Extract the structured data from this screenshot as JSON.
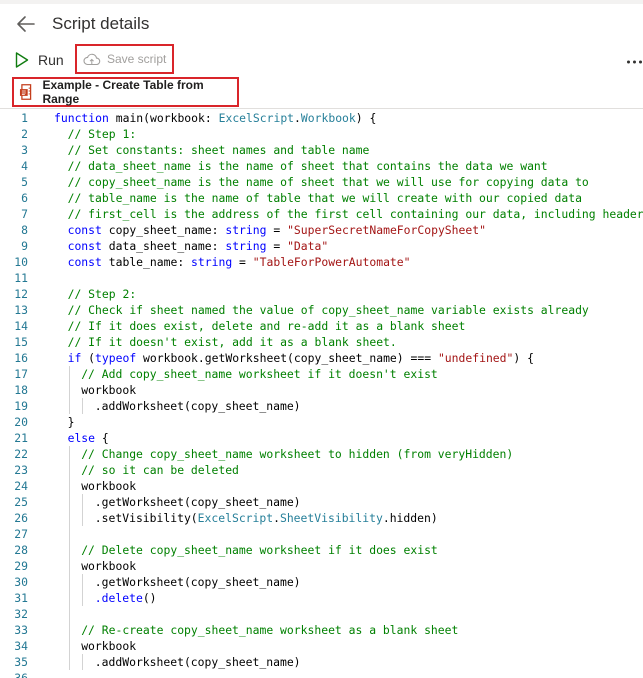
{
  "header": {
    "title": "Script details",
    "back_icon": "arrow-left-icon"
  },
  "toolbar": {
    "run_label": "Run",
    "save_label": "Save script",
    "more_label": "⋯"
  },
  "script": {
    "name": "Example - Create Table from Range"
  },
  "colors": {
    "highlight_border": "#d9252a",
    "run_icon": "#107c10",
    "comment": "#008000",
    "keyword": "#0000ff",
    "string": "#a31515",
    "type": "#267f99",
    "line_number": "#237893"
  },
  "code_lines": [
    {
      "n": "1",
      "indent": 0,
      "tokens": [
        {
          "t": "function",
          "k": "kw"
        },
        {
          "t": " main(workbook: ",
          "k": "plain"
        },
        {
          "t": "ExcelScript",
          "k": "type"
        },
        {
          "t": ".",
          "k": "plain"
        },
        {
          "t": "Workbook",
          "k": "type"
        },
        {
          "t": ") {",
          "k": "plain"
        }
      ]
    },
    {
      "n": "2",
      "indent": 1,
      "tokens": [
        {
          "t": "// Step 1:",
          "k": "com"
        }
      ]
    },
    {
      "n": "3",
      "indent": 1,
      "tokens": [
        {
          "t": "// Set constants: sheet names and table name",
          "k": "com"
        }
      ]
    },
    {
      "n": "4",
      "indent": 1,
      "tokens": [
        {
          "t": "// data_sheet_name is the name of sheet that contains the data we want",
          "k": "com"
        }
      ]
    },
    {
      "n": "5",
      "indent": 1,
      "tokens": [
        {
          "t": "// copy_sheet_name is the name of sheet that we will use for copying data to",
          "k": "com"
        }
      ]
    },
    {
      "n": "6",
      "indent": 1,
      "tokens": [
        {
          "t": "// table_name is the name of table that we will create with our copied data",
          "k": "com"
        }
      ]
    },
    {
      "n": "7",
      "indent": 1,
      "tokens": [
        {
          "t": "// first_cell is the address of the first cell containing our data, including headers",
          "k": "com"
        }
      ]
    },
    {
      "n": "8",
      "indent": 1,
      "tokens": [
        {
          "t": "const",
          "k": "kw"
        },
        {
          "t": " copy_sheet_name: ",
          "k": "plain"
        },
        {
          "t": "string",
          "k": "kw"
        },
        {
          "t": " = ",
          "k": "plain"
        },
        {
          "t": "\"SuperSecretNameForCopySheet\"",
          "k": "str"
        }
      ]
    },
    {
      "n": "9",
      "indent": 1,
      "tokens": [
        {
          "t": "const",
          "k": "kw"
        },
        {
          "t": " data_sheet_name: ",
          "k": "plain"
        },
        {
          "t": "string",
          "k": "kw"
        },
        {
          "t": " = ",
          "k": "plain"
        },
        {
          "t": "\"Data\"",
          "k": "str"
        }
      ]
    },
    {
      "n": "10",
      "indent": 1,
      "tokens": [
        {
          "t": "const",
          "k": "kw"
        },
        {
          "t": " table_name: ",
          "k": "plain"
        },
        {
          "t": "string",
          "k": "kw"
        },
        {
          "t": " = ",
          "k": "plain"
        },
        {
          "t": "\"TableForPowerAutomate\"",
          "k": "str"
        }
      ]
    },
    {
      "n": "11",
      "indent": 1,
      "tokens": []
    },
    {
      "n": "12",
      "indent": 1,
      "tokens": [
        {
          "t": "// Step 2:",
          "k": "com"
        }
      ]
    },
    {
      "n": "13",
      "indent": 1,
      "tokens": [
        {
          "t": "// Check if sheet named the value of copy_sheet_name variable exists already",
          "k": "com"
        }
      ]
    },
    {
      "n": "14",
      "indent": 1,
      "tokens": [
        {
          "t": "// If it does exist, delete and re-add it as a blank sheet",
          "k": "com"
        }
      ]
    },
    {
      "n": "15",
      "indent": 1,
      "tokens": [
        {
          "t": "// If it doesn't exist, add it as a blank sheet.",
          "k": "com"
        }
      ]
    },
    {
      "n": "16",
      "indent": 1,
      "tokens": [
        {
          "t": "if",
          "k": "kw"
        },
        {
          "t": " (",
          "k": "plain"
        },
        {
          "t": "typeof",
          "k": "kw"
        },
        {
          "t": " workbook.getWorksheet(copy_sheet_name) === ",
          "k": "plain"
        },
        {
          "t": "\"undefined\"",
          "k": "str"
        },
        {
          "t": ") {",
          "k": "plain"
        }
      ]
    },
    {
      "n": "17",
      "indent": 2,
      "tokens": [
        {
          "t": "// Add copy_sheet_name worksheet if it doesn't exist",
          "k": "com"
        }
      ]
    },
    {
      "n": "18",
      "indent": 2,
      "tokens": [
        {
          "t": "workbook",
          "k": "plain"
        }
      ]
    },
    {
      "n": "19",
      "indent": 3,
      "tokens": [
        {
          "t": ".addWorksheet(copy_sheet_name)",
          "k": "plain"
        }
      ]
    },
    {
      "n": "20",
      "indent": 1,
      "tokens": [
        {
          "t": "}",
          "k": "plain"
        }
      ]
    },
    {
      "n": "21",
      "indent": 1,
      "tokens": [
        {
          "t": "else",
          "k": "kw"
        },
        {
          "t": " {",
          "k": "plain"
        }
      ]
    },
    {
      "n": "22",
      "indent": 2,
      "tokens": [
        {
          "t": "// Change copy_sheet_name worksheet to hidden (from veryHidden)",
          "k": "com"
        }
      ]
    },
    {
      "n": "23",
      "indent": 2,
      "tokens": [
        {
          "t": "// so it can be deleted",
          "k": "com"
        }
      ]
    },
    {
      "n": "24",
      "indent": 2,
      "tokens": [
        {
          "t": "workbook",
          "k": "plain"
        }
      ]
    },
    {
      "n": "25",
      "indent": 3,
      "tokens": [
        {
          "t": ".getWorksheet(copy_sheet_name)",
          "k": "plain"
        }
      ]
    },
    {
      "n": "26",
      "indent": 3,
      "tokens": [
        {
          "t": ".setVisibility(",
          "k": "plain"
        },
        {
          "t": "ExcelScript",
          "k": "type"
        },
        {
          "t": ".",
          "k": "plain"
        },
        {
          "t": "SheetVisibility",
          "k": "type"
        },
        {
          "t": ".hidden)",
          "k": "plain"
        }
      ]
    },
    {
      "n": "27",
      "indent": 2,
      "tokens": []
    },
    {
      "n": "28",
      "indent": 2,
      "tokens": [
        {
          "t": "// Delete copy_sheet_name worksheet if it does exist",
          "k": "com"
        }
      ]
    },
    {
      "n": "29",
      "indent": 2,
      "tokens": [
        {
          "t": "workbook",
          "k": "plain"
        }
      ]
    },
    {
      "n": "30",
      "indent": 3,
      "tokens": [
        {
          "t": ".getWorksheet(copy_sheet_name)",
          "k": "plain"
        }
      ]
    },
    {
      "n": "31",
      "indent": 3,
      "tokens": [
        {
          "t": ".delete",
          "k": "kw"
        },
        {
          "t": "()",
          "k": "plain"
        }
      ]
    },
    {
      "n": "32",
      "indent": 2,
      "tokens": []
    },
    {
      "n": "33",
      "indent": 2,
      "tokens": [
        {
          "t": "// Re-create copy_sheet_name worksheet as a blank sheet",
          "k": "com"
        }
      ]
    },
    {
      "n": "34",
      "indent": 2,
      "tokens": [
        {
          "t": "workbook",
          "k": "plain"
        }
      ]
    },
    {
      "n": "35",
      "indent": 3,
      "tokens": [
        {
          "t": ".addWorksheet(copy_sheet_name)",
          "k": "plain"
        }
      ]
    },
    {
      "n": "36",
      "indent": 1,
      "tokens": []
    }
  ]
}
